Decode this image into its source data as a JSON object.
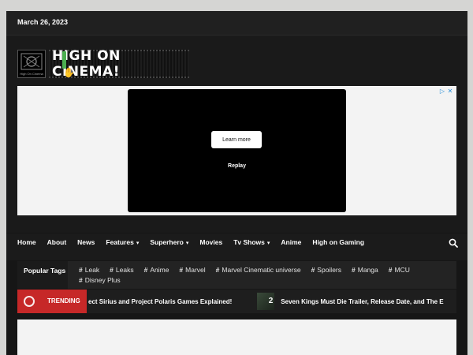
{
  "topbar": {
    "date": "March 26, 2023"
  },
  "logo": {
    "text": "HIGH ON CINEMA!",
    "emblem_tag": "High On Cinema"
  },
  "ad": {
    "learn_more_label": "Learn more",
    "replay_label": "Replay",
    "choices_icon": "info-icon",
    "close_icon": "close-icon"
  },
  "nav": {
    "items": [
      {
        "label": "Home",
        "active": true
      },
      {
        "label": "About"
      },
      {
        "label": "News"
      },
      {
        "label": "Features",
        "dropdown": true
      },
      {
        "label": "Superhero",
        "dropdown": true
      },
      {
        "label": "Movies"
      },
      {
        "label": "Tv Shows",
        "dropdown": true
      },
      {
        "label": "Anime"
      },
      {
        "label": "High on Gaming"
      }
    ],
    "search_icon": "search-icon"
  },
  "tags": {
    "title": "Popular Tags",
    "items": [
      "Leak",
      "Leaks",
      "Anime",
      "Marvel",
      "Marvel Cinematic universe",
      "Spoilers",
      "Manga",
      "MCU",
      "Disney Plus"
    ]
  },
  "trending": {
    "label": "TRENDING",
    "items": [
      {
        "text": "ect Sirius and Project Polaris Games Explained!"
      },
      {
        "number": "2",
        "text": "Seven Kings Must Die Trailer, Release Date, and The E"
      }
    ]
  },
  "colors": {
    "accent": "#c62828",
    "background": "#161616"
  }
}
